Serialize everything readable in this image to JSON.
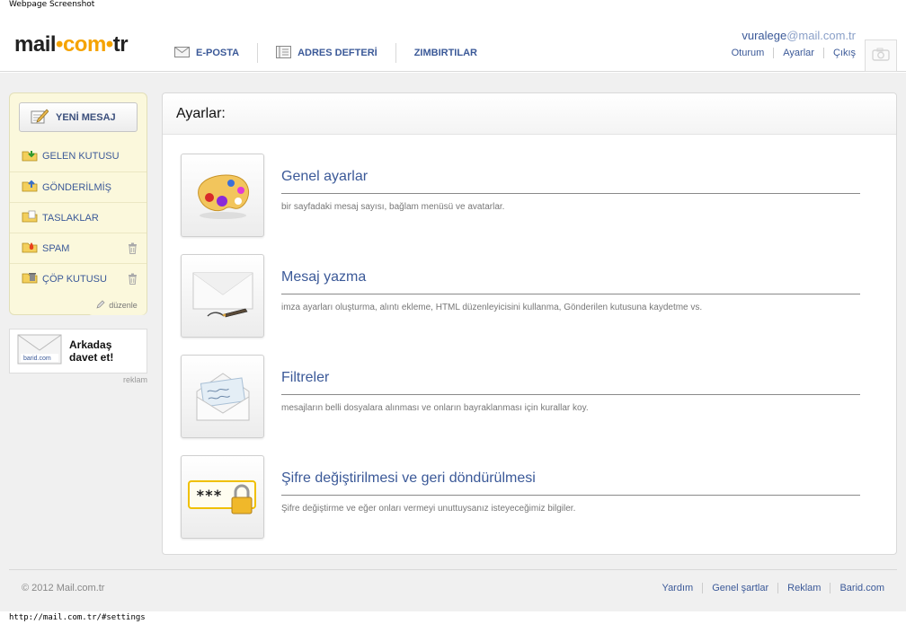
{
  "caption": "Webpage Screenshot",
  "status_url": "http://mail.com.tr/#settings",
  "logo": {
    "part1": "mail",
    "dot1": "•",
    "part2": "com",
    "dot2": "•",
    "part3": "tr"
  },
  "topnav": [
    {
      "label": "E-POSTA",
      "icon": "envelope-icon"
    },
    {
      "label": "ADRES DEFTERİ",
      "icon": "address-book-icon"
    },
    {
      "label": "ZIMBIRTILAR",
      "icon": ""
    }
  ],
  "user": {
    "name": "vuralege",
    "domain": "@mail.com.tr",
    "links": [
      "Oturum",
      "Ayarlar",
      "Çıkış"
    ]
  },
  "sidebar": {
    "compose_label": "YENİ MESAJ",
    "folders": [
      {
        "label": "GELEN KUTUSU",
        "icon": "inbox-folder-icon"
      },
      {
        "label": "GÖNDERİLMİŞ",
        "icon": "sent-folder-icon"
      },
      {
        "label": "TASLAKLAR",
        "icon": "drafts-folder-icon"
      },
      {
        "label": "SPAM",
        "icon": "spam-folder-icon"
      },
      {
        "label": "ÇÖP KUTUSU",
        "icon": "trash-folder-icon"
      }
    ],
    "edit_label": "düzenle",
    "invite_line1": "Arkadaş",
    "invite_line2": "davet et!",
    "invite_brand": "barid.com",
    "ad_label": "reklam"
  },
  "panel": {
    "title": "Ayarlar:",
    "items": [
      {
        "title": "Genel ayarlar",
        "desc": "bir sayfadaki mesaj sayısı, bağlam menüsü ve avatarlar.",
        "icon": "palette-icon"
      },
      {
        "title": "Mesaj yazma",
        "desc": "imza ayarları oluşturma, alıntı ekleme, HTML düzenleyicisini kullanma, Gönderilen kutusuna kaydetme vs.",
        "icon": "envelope-pen-icon"
      },
      {
        "title": "Filtreler",
        "desc": "mesajların belli dosyalara alınması ve onların bayraklanması için kurallar koy.",
        "icon": "open-letter-icon"
      },
      {
        "title": "Şifre değiştirilmesi ve geri döndürülmesi",
        "desc": "Şifre değiştirme ve eğer onları vermeyi unuttuysanız isteyeceğimiz bilgiler.",
        "icon": "password-lock-icon",
        "password_mask": "***"
      }
    ]
  },
  "footer": {
    "copyright": "© 2012 Mail.com.tr",
    "links": [
      "Yardım",
      "Genel şartlar",
      "Reklam",
      "Barid.com"
    ]
  },
  "colors": {
    "link": "#3b5998",
    "accent": "#f5a300",
    "sidebar_bg": "#fbf8dc"
  }
}
